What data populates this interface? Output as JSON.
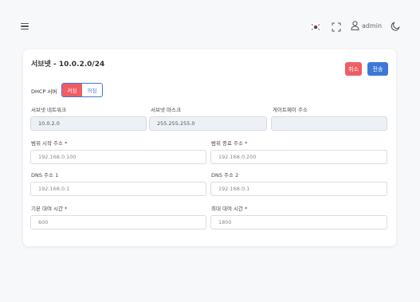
{
  "header": {
    "user_label": "admin"
  },
  "form": {
    "title": "서브넷 - 10.0.2.0/24",
    "cancel_label": "취소",
    "submit_label": "전송",
    "dhcp": {
      "label": "DHCP 서버",
      "on_label": "켜짐",
      "off_label": "꺼짐"
    },
    "subnet_network": {
      "label": "서브넷 네트워크",
      "value": "10.0.2.0"
    },
    "subnet_mask": {
      "label": "서브넷 마스크",
      "value": "255.255.255.0"
    },
    "gateway": {
      "label": "게이트웨이 주소",
      "value": ""
    },
    "range_start": {
      "label": "범위 시작 주소 *",
      "placeholder": "192.168.0.100"
    },
    "range_end": {
      "label": "범위 종료 주소 *",
      "placeholder": "192.168.0.200"
    },
    "dns1": {
      "label": "DNS 주소 1",
      "placeholder": "192.168.0.1"
    },
    "dns2": {
      "label": "DNS 주소 2",
      "placeholder": "192.168.0.1"
    },
    "default_lease": {
      "label": "기본 대여 시간 *",
      "placeholder": "600"
    },
    "max_lease": {
      "label": "최대 대여 시간 *",
      "placeholder": "1800"
    }
  },
  "colors": {
    "danger": "#f05d63",
    "primary": "#3d78d8"
  }
}
